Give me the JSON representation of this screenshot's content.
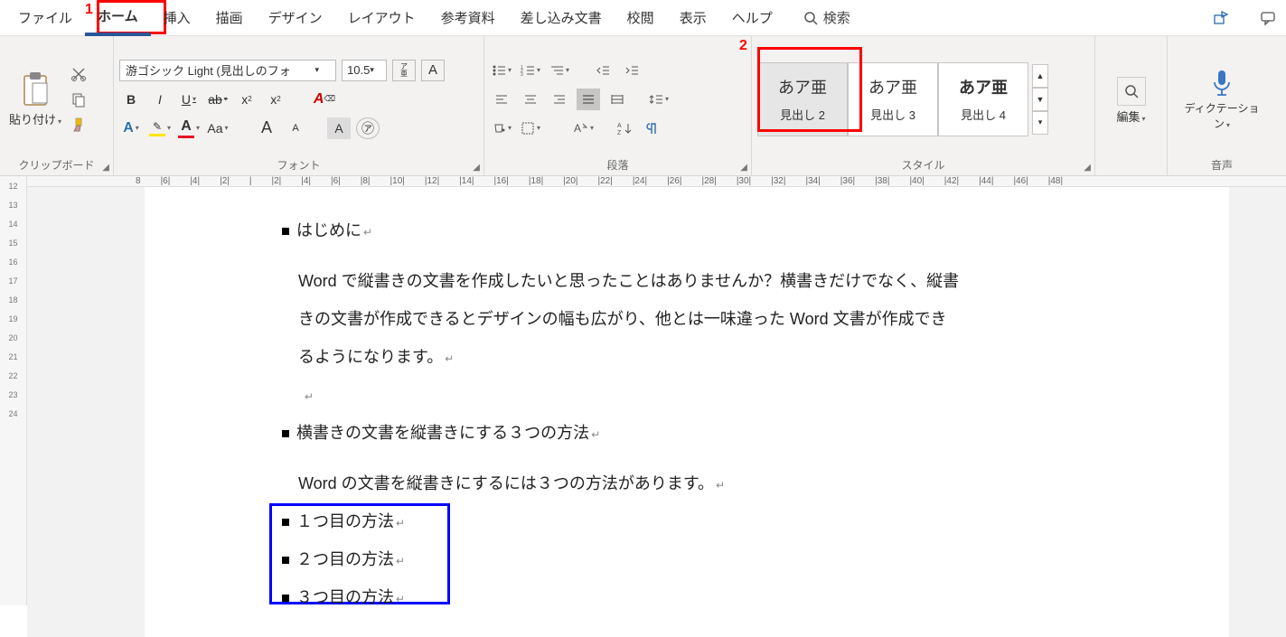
{
  "menu": {
    "items": [
      "ファイル",
      "ホーム",
      "挿入",
      "描画",
      "デザイン",
      "レイアウト",
      "参考資料",
      "差し込み文書",
      "校閲",
      "表示",
      "ヘルプ"
    ],
    "active_index": 1,
    "search_label": "検索"
  },
  "annotations": {
    "one": "1",
    "two": "2"
  },
  "ribbon": {
    "clipboard": {
      "paste_label": "貼り付け",
      "group_label": "クリップボード"
    },
    "font": {
      "font_name": "游ゴシック Light (見出しのフォ",
      "font_size": "10.5",
      "ruby_top": "ア",
      "ruby_bottom": "亜",
      "char_border": "A",
      "bold": "B",
      "italic": "I",
      "underline": "U",
      "strike": "ab",
      "sub": "x",
      "sup": "x",
      "aa_label": "Aa",
      "larger": "A",
      "smaller": "A",
      "highlight": "A",
      "circled": "㋐",
      "group_label": "フォント"
    },
    "paragraph": {
      "sort": "A↓Z",
      "show": "¶",
      "group_label": "段落"
    },
    "styles": {
      "preview": "あア亜",
      "items": [
        {
          "name": "見出し 2",
          "selected": true,
          "bold": false
        },
        {
          "name": "見出し 3",
          "selected": false,
          "bold": false
        },
        {
          "name": "見出し 4",
          "selected": false,
          "bold": true
        }
      ],
      "group_label": "スタイル"
    },
    "editing": {
      "label": "編集"
    },
    "dictation": {
      "label": "ディクテーション",
      "group_label": "音声"
    }
  },
  "hruler": [
    "8",
    "|6|",
    "|4|",
    "|2|",
    "|",
    "|2|",
    "|4|",
    "|6|",
    "|8|",
    "|10|",
    "|12|",
    "|14|",
    "|16|",
    "|18|",
    "|20|",
    "|22|",
    "|24|",
    "|26|",
    "|28|",
    "|30|",
    "|32|",
    "|34|",
    "|36|",
    "|38|",
    "|40|",
    "|42|",
    "|44|",
    "|46|",
    "|48|"
  ],
  "vruler": [
    "12",
    "13",
    "14",
    "15",
    "16",
    "17",
    "18",
    "19",
    "20",
    "21",
    "22",
    "23",
    "24"
  ],
  "document": {
    "h1": "はじめに",
    "body1a": "Word で縦書きの文書を作成したいと思ったことはありませんか？横書きだけでなく、縦書",
    "body1b": "きの文書が作成できるとデザインの幅も広がり、他とは一味違った Word 文書が作成でき",
    "body1c": "るようになります。",
    "h2": "横書きの文書を縦書きにする３つの方法",
    "body2": "Word の文書を縦書きにするには３つの方法があります。",
    "m1": "１つ目の方法",
    "m2": "２つ目の方法",
    "m3": "３つ目の方法"
  }
}
